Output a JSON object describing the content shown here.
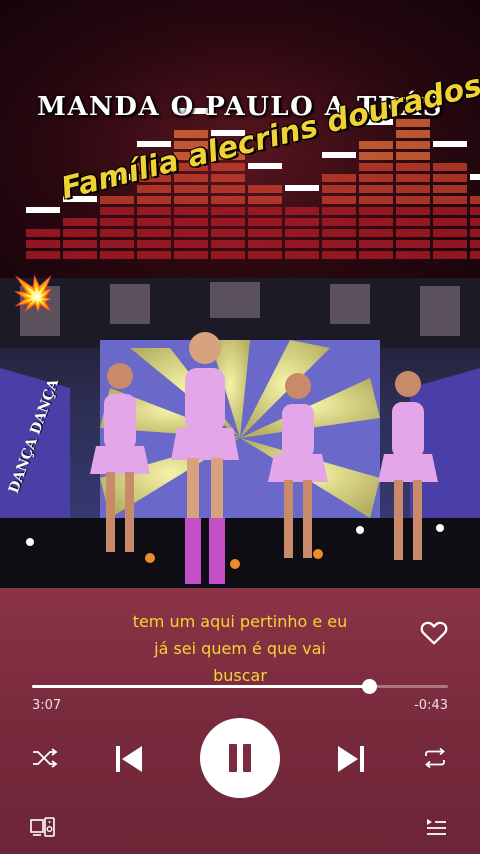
{
  "banner": {
    "title": "MANDA O PAULO A TRÁS",
    "subtitle": "Família alecrins dourados"
  },
  "video": {
    "side_tag": "DANÇA DANÇA",
    "spark_icon": "sparkle-burst-icon"
  },
  "player": {
    "lyrics_lines": [
      "tem um aqui pertinho e eu",
      "já sei quem é que vai",
      "buscar"
    ],
    "progress_fraction": 0.81,
    "elapsed": "3:07",
    "remaining": "-0:43",
    "state": "playing",
    "icons": {
      "like": "heart-outline-icon",
      "shuffle": "shuffle-icon",
      "previous": "skip-previous-icon",
      "pause": "pause-icon",
      "next": "skip-next-icon",
      "repeat": "repeat-icon",
      "devices": "devices-icon",
      "queue": "queue-icon"
    }
  },
  "colors": {
    "lyrics": "#f3d534",
    "subtitle": "#f1d234",
    "player_bg": "#7a2b3e",
    "dancer_outfit": "#e3a6e8"
  }
}
